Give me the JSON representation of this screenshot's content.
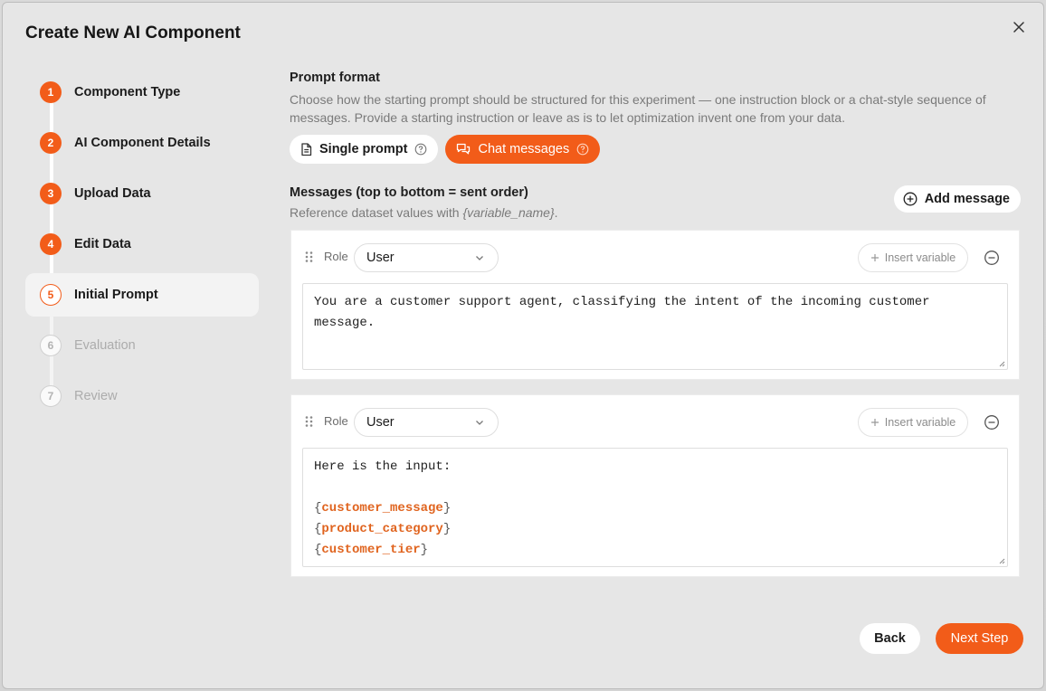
{
  "modal": {
    "title": "Create New AI Component"
  },
  "steps": [
    {
      "num": "1",
      "label": "Component Type",
      "state": "done"
    },
    {
      "num": "2",
      "label": "AI Component Details",
      "state": "done"
    },
    {
      "num": "3",
      "label": "Upload Data",
      "state": "done"
    },
    {
      "num": "4",
      "label": "Edit Data",
      "state": "done"
    },
    {
      "num": "5",
      "label": "Initial Prompt",
      "state": "current"
    },
    {
      "num": "6",
      "label": "Evaluation",
      "state": "future"
    },
    {
      "num": "7",
      "label": "Review",
      "state": "future"
    }
  ],
  "prompt_format": {
    "title": "Prompt format",
    "description": "Choose how the starting prompt should be structured for this experiment — one instruction block or a chat-style sequence of messages. Provide a starting instruction or leave as is to let optimization invent one from your data.",
    "options": [
      {
        "label": "Single prompt",
        "selected": false
      },
      {
        "label": "Chat messages",
        "selected": true
      }
    ]
  },
  "messages": {
    "title": "Messages (top to bottom = sent order)",
    "subtitle_prefix": "Reference dataset values with ",
    "subtitle_var": "{variable_name}",
    "subtitle_suffix": ".",
    "add_label": "Add message",
    "role_label": "Role",
    "insert_label": "Insert variable",
    "items": [
      {
        "role": "User",
        "text": "You are a customer support agent, classifying the intent of the incoming customer message."
      },
      {
        "role": "User",
        "text_intro": "Here is the input:",
        "variables": [
          "customer_message",
          "product_category",
          "customer_tier"
        ]
      }
    ]
  },
  "footer": {
    "back_label": "Back",
    "next_label": "Next Step"
  },
  "colors": {
    "accent": "#f25c19",
    "variable": "#e0641f",
    "background": "#e6e6e6"
  },
  "icons": {
    "close": "close-icon",
    "document": "document-icon",
    "chat": "chat-bubbles-icon",
    "help": "help-circle-icon",
    "add": "plus-circle-icon",
    "drag": "drag-handle-icon",
    "chevron": "chevron-down-icon",
    "plus": "plus-icon",
    "remove": "minus-circle-icon"
  }
}
